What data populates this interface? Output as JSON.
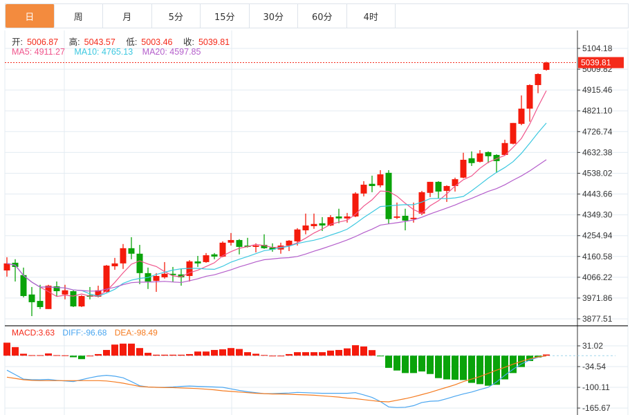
{
  "tabs": [
    {
      "label": "日",
      "active": true
    },
    {
      "label": "周"
    },
    {
      "label": "月"
    },
    {
      "label": "5分"
    },
    {
      "label": "15分"
    },
    {
      "label": "30分"
    },
    {
      "label": "60分"
    },
    {
      "label": "4时"
    }
  ],
  "ohlc_info": {
    "open_label": "开:",
    "open": "5006.87",
    "high_label": "高:",
    "high": "5043.57",
    "low_label": "低:",
    "low": "5003.46",
    "close_label": "收:",
    "close": "5039.81"
  },
  "ma_info": {
    "ma5": "MA5: 4911.27",
    "ma10": "MA10: 4765.13",
    "ma20": "MA20: 4597.85"
  },
  "macd_info": {
    "macd": "MACD:3.63",
    "diff": "DIFF:-96.68",
    "dea": "DEA:-98.49"
  },
  "colors": {
    "up": "#f41b0c",
    "down": "#0aa30a",
    "ma5": "#f0558c",
    "ma10": "#3cc8e0",
    "ma20": "#b45ecb",
    "diff": "#4aa6f0",
    "dea": "#f57b20",
    "active_tab": "#f38b3e",
    "grid": "#e3ebf2"
  },
  "chart_data": [
    {
      "type": "candlestick",
      "price_axis_ticks": [
        "5104.18",
        "5009.82",
        "4915.46",
        "4821.10",
        "4726.74",
        "4632.38",
        "4538.02",
        "4443.66",
        "4349.30",
        "4254.94",
        "4160.58",
        "4066.22",
        "3971.86",
        "3877.51"
      ],
      "ylim": [
        3877.51,
        5104.18
      ],
      "current_price": "5039.81",
      "grid": true,
      "moving_averages": [
        "MA5",
        "MA10",
        "MA20"
      ],
      "ohlc": [
        [
          4097,
          4157,
          4069,
          4129
        ],
        [
          4132,
          4148,
          4047,
          4113
        ],
        [
          4076,
          4110,
          3975,
          3981
        ],
        [
          3988,
          4022,
          3890,
          3953
        ],
        [
          3959,
          4032,
          3922,
          3931
        ],
        [
          3922,
          4032,
          3922,
          4028
        ],
        [
          4025,
          4047,
          3978,
          4003
        ],
        [
          3988,
          4032,
          3966,
          4007
        ],
        [
          4003,
          4007,
          3931,
          3934
        ],
        [
          3934,
          3985,
          3931,
          3981
        ],
        [
          3985,
          4022,
          3966,
          3978
        ],
        [
          3978,
          4028,
          3975,
          4007
        ],
        [
          4000,
          4122,
          3997,
          4119
        ],
        [
          4116,
          4154,
          4100,
          4129
        ],
        [
          4129,
          4217,
          4104,
          4198
        ],
        [
          4198,
          4248,
          4148,
          4173
        ],
        [
          4173,
          4213,
          4035,
          4085
        ],
        [
          4085,
          4110,
          4013,
          4047
        ],
        [
          4050,
          4085,
          4000,
          4072
        ],
        [
          4066,
          4135,
          4060,
          4082
        ],
        [
          4082,
          4113,
          4044,
          4076
        ],
        [
          4079,
          4104,
          4028,
          4066
        ],
        [
          4072,
          4144,
          4047,
          4138
        ],
        [
          4138,
          4163,
          4113,
          4129
        ],
        [
          4135,
          4176,
          4132,
          4166
        ],
        [
          4170,
          4176,
          4148,
          4160
        ],
        [
          4160,
          4229,
          4157,
          4223
        ],
        [
          4223,
          4267,
          4210,
          4235
        ],
        [
          4235,
          4239,
          4170,
          4204
        ],
        [
          4210,
          4245,
          4201,
          4204
        ],
        [
          4204,
          4220,
          4179,
          4210
        ],
        [
          4213,
          4261,
          4195,
          4198
        ],
        [
          4201,
          4220,
          4182,
          4192
        ],
        [
          4192,
          4223,
          4173,
          4210
        ],
        [
          4210,
          4235,
          4185,
          4232
        ],
        [
          4229,
          4289,
          4210,
          4283
        ],
        [
          4279,
          4355,
          4261,
          4301
        ],
        [
          4298,
          4355,
          4286,
          4308
        ],
        [
          4311,
          4339,
          4276,
          4301
        ],
        [
          4301,
          4348,
          4298,
          4339
        ],
        [
          4342,
          4377,
          4311,
          4333
        ],
        [
          4333,
          4358,
          4314,
          4342
        ],
        [
          4342,
          4452,
          4339,
          4446
        ],
        [
          4446,
          4502,
          4433,
          4486
        ],
        [
          4490,
          4527,
          4452,
          4480
        ],
        [
          4483,
          4552,
          4474,
          4533
        ],
        [
          4540,
          4552,
          4308,
          4330
        ],
        [
          4336,
          4405,
          4330,
          4342
        ],
        [
          4345,
          4377,
          4279,
          4323
        ],
        [
          4330,
          4405,
          4314,
          4336
        ],
        [
          4355,
          4458,
          4348,
          4452
        ],
        [
          4449,
          4499,
          4430,
          4499
        ],
        [
          4499,
          4502,
          4424,
          4455
        ],
        [
          4458,
          4483,
          4408,
          4480
        ],
        [
          4480,
          4518,
          4455,
          4511
        ],
        [
          4518,
          4631,
          4515,
          4599
        ],
        [
          4606,
          4637,
          4571,
          4584
        ],
        [
          4590,
          4643,
          4587,
          4628
        ],
        [
          4634,
          4637,
          4584,
          4615
        ],
        [
          4621,
          4624,
          4540,
          4593
        ],
        [
          4621,
          4690,
          4618,
          4675
        ],
        [
          4672,
          4766,
          4669,
          4766
        ],
        [
          4762,
          4891,
          4756,
          4831
        ],
        [
          4831,
          4941,
          4772,
          4938
        ],
        [
          4938,
          4991,
          4901,
          4988
        ],
        [
          5006.87,
          5043.57,
          5003.46,
          5039.81
        ]
      ]
    },
    {
      "type": "macd",
      "axis_ticks": [
        "31.02",
        "-34.54",
        "-100.11",
        "-165.67"
      ],
      "ylim": [
        -165.67,
        31.02
      ],
      "histogram": [
        41,
        27,
        6,
        1.5,
        1.5,
        7,
        1.5,
        1,
        -5,
        -11,
        0,
        5,
        18,
        35,
        38,
        38,
        24,
        9,
        3,
        3,
        3,
        3,
        5,
        13,
        13,
        18,
        20,
        24,
        21,
        11,
        6,
        2,
        0,
        0,
        5,
        11,
        11,
        11,
        11,
        16,
        18,
        23,
        33,
        29,
        17.5,
        -1,
        -38.6,
        -47,
        -55,
        -55,
        -50,
        -58,
        -71,
        -75,
        -76,
        -77,
        -86,
        -90,
        -95,
        -92,
        -75,
        -55,
        -36,
        -17,
        -6,
        3.63
      ],
      "diff": [
        -46,
        -60,
        -74,
        -76,
        -76,
        -75,
        -78,
        -80,
        -82,
        -76,
        -70,
        -65,
        -62,
        -65,
        -70,
        -82,
        -95,
        -99,
        -100,
        -100,
        -99,
        -97,
        -96,
        -97,
        -98,
        -99,
        -100,
        -105,
        -110,
        -114,
        -117,
        -120,
        -120,
        -119,
        -118,
        -116,
        -117,
        -118,
        -119,
        -119,
        -119,
        -119,
        -117,
        -124,
        -132,
        -145,
        -162,
        -164,
        -163,
        -158,
        -148,
        -144,
        -143,
        -136,
        -128,
        -121,
        -115,
        -107,
        -100,
        -83,
        -62,
        -43,
        -26,
        -14,
        -5,
        -1
      ],
      "dea": [
        -68,
        -72,
        -76,
        -78,
        -79,
        -79,
        -79,
        -79,
        -79,
        -79,
        -79,
        -79,
        -80,
        -83,
        -87,
        -92,
        -97,
        -99,
        -100,
        -101,
        -101,
        -102,
        -103,
        -104,
        -106,
        -108,
        -111,
        -113,
        -115,
        -117,
        -119,
        -120,
        -121,
        -121,
        -122,
        -123,
        -124,
        -125,
        -127,
        -129,
        -131,
        -134,
        -136,
        -139,
        -142,
        -145,
        -146,
        -141,
        -136,
        -130,
        -123,
        -116,
        -108,
        -100,
        -92,
        -82,
        -74,
        -66,
        -56,
        -46,
        -37,
        -27,
        -18,
        -10,
        -4,
        -1
      ]
    }
  ]
}
